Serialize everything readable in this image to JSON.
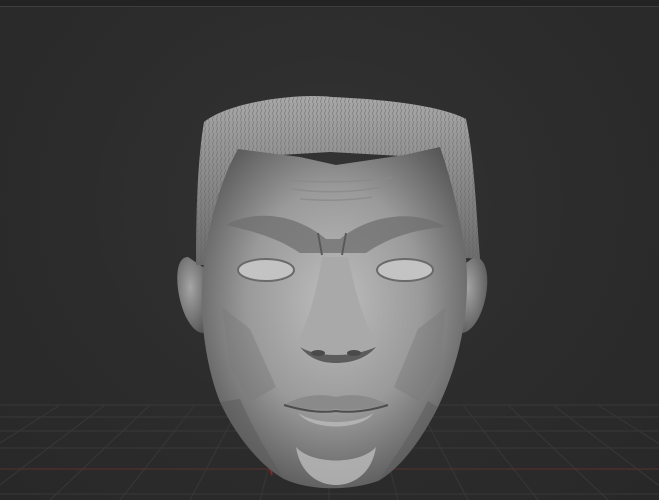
{
  "app": {
    "viewport_label": "3D viewport",
    "model": "sculpted-head"
  },
  "colors": {
    "background": "#2b2b2b",
    "grid": "#3a3a3a",
    "grid_axis_red": "#6a2e2e",
    "grid_axis_green": "#2e5a3a",
    "clay_light": "#b5b5b5",
    "clay_mid": "#8c8c8c",
    "clay_dark": "#4a4a4a"
  }
}
